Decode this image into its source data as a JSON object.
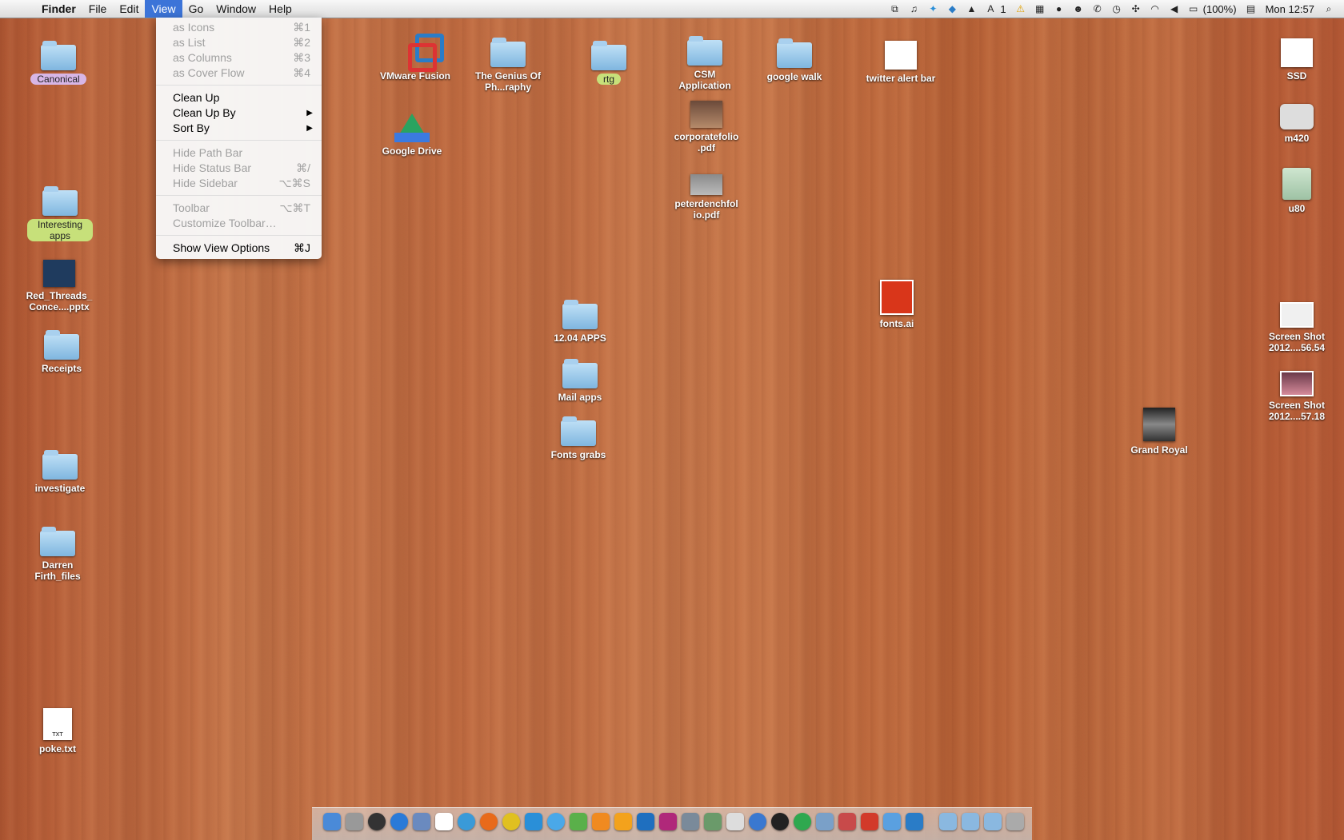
{
  "menubar": {
    "app_name": "Finder",
    "menus": [
      "File",
      "Edit",
      "View",
      "Go",
      "Window",
      "Help"
    ],
    "active_menu": "View",
    "status": {
      "notification_count": "1",
      "battery": "(100%)",
      "clock": "Mon 12:57"
    }
  },
  "view_menu": {
    "items": [
      {
        "label": "as Icons",
        "shortcut": "⌘1",
        "enabled": false
      },
      {
        "label": "as List",
        "shortcut": "⌘2",
        "enabled": false
      },
      {
        "label": "as Columns",
        "shortcut": "⌘3",
        "enabled": false
      },
      {
        "label": "as Cover Flow",
        "shortcut": "⌘4",
        "enabled": false
      },
      {
        "label": "Clean Up",
        "shortcut": "",
        "enabled": true
      },
      {
        "label": "Clean Up By",
        "shortcut": "",
        "enabled": true,
        "submenu": true
      },
      {
        "label": "Sort By",
        "shortcut": "",
        "enabled": true,
        "submenu": true
      },
      {
        "label": "Hide Path Bar",
        "shortcut": "",
        "enabled": false
      },
      {
        "label": "Hide Status Bar",
        "shortcut": "⌘/",
        "enabled": false
      },
      {
        "label": "Hide Sidebar",
        "shortcut": "⌥⌘S",
        "enabled": false
      },
      {
        "label": "Toolbar",
        "shortcut": "⌥⌘T",
        "enabled": false
      },
      {
        "label": "Customize Toolbar…",
        "shortcut": "",
        "enabled": false
      },
      {
        "label": "Show View Options",
        "shortcut": "⌘J",
        "enabled": true
      }
    ]
  },
  "desktop": {
    "canonical": "Canonical",
    "interesting_apps": "Interesting apps",
    "red_threads": "Red_Threads_ Conce....pptx",
    "receipts": "Receipts",
    "investigate": "investigate",
    "darren": "Darren Firth_files",
    "poke": "poke.txt",
    "vmware": "VMware Fusion",
    "google_drive": "Google Drive",
    "genius": "The Genius Of Ph...raphy",
    "rtg": "rtg",
    "csm": "CSM Application",
    "google_walk": "google walk",
    "twitter_alert": "twitter alert bar",
    "corporatefolio": "corporatefolio .pdf",
    "peterdench": "peterdenchfol io.pdf",
    "apps1204": "12.04 APPS",
    "mail_apps": "Mail apps",
    "fonts_grabs": "Fonts grabs",
    "fonts_ai": "fonts.ai",
    "ssd": "SSD",
    "m420": "m420",
    "u80": "u80",
    "shot1": "Screen Shot 2012....56.54",
    "shot2": "Screen Shot 2012....57.18",
    "grand_royal": "Grand Royal"
  },
  "colors": {
    "menu_highlight": "#3c74d8",
    "tag_purple": "#d7b6e6",
    "tag_green": "#c7e07a"
  }
}
